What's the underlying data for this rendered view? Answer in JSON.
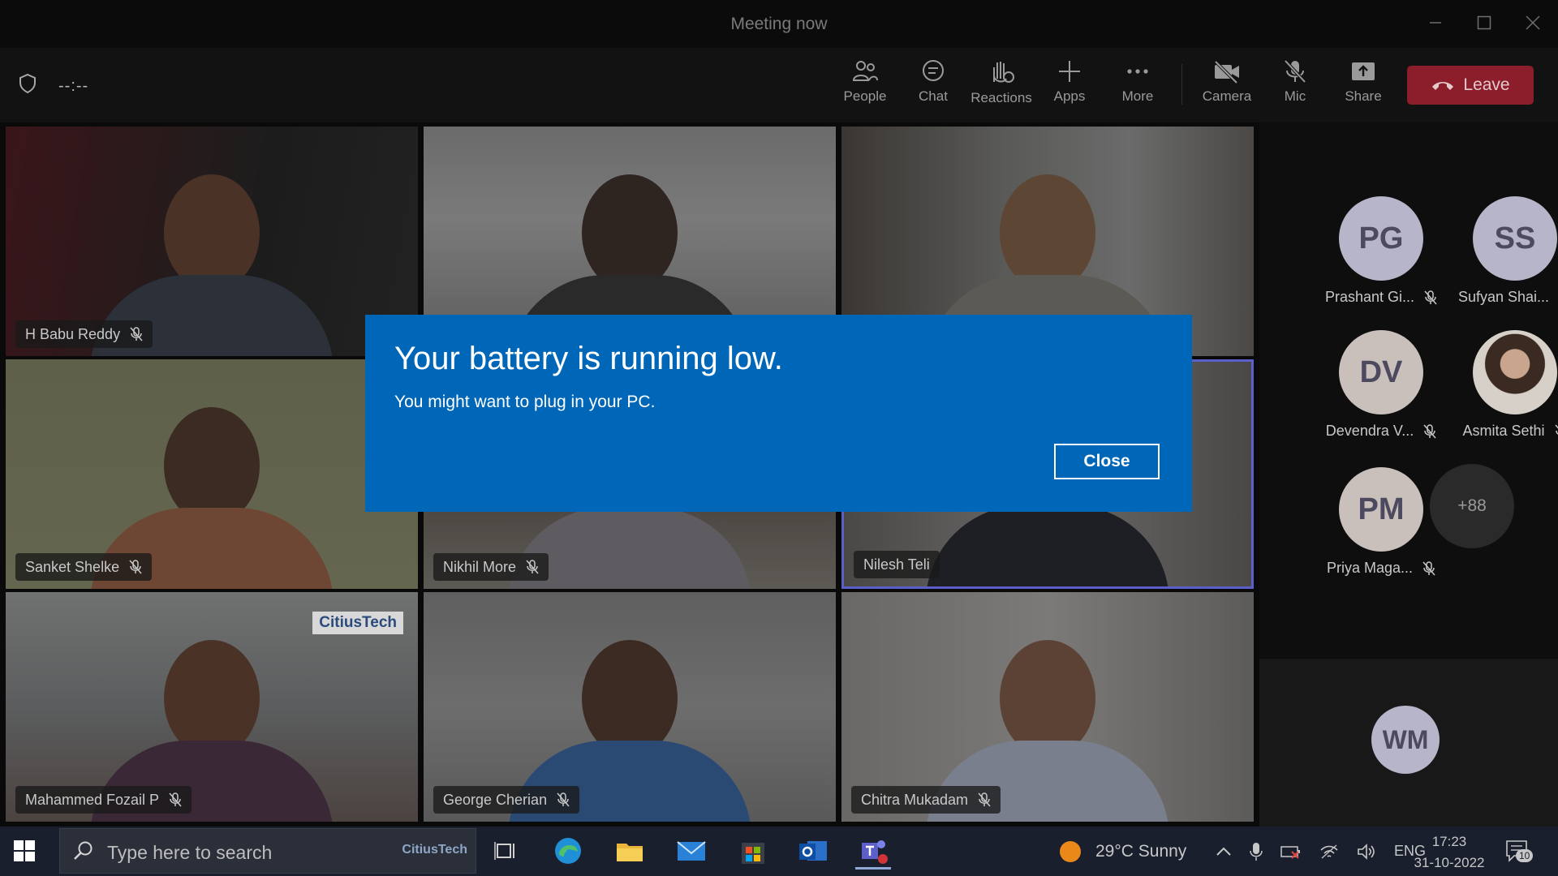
{
  "window": {
    "title": "Meeting now"
  },
  "toolbar": {
    "timer": "--:--",
    "buttons": {
      "people": "People",
      "chat": "Chat",
      "reactions": "Reactions",
      "apps": "Apps",
      "more": "More",
      "camera": "Camera",
      "mic": "Mic",
      "share": "Share"
    },
    "leave_label": "Leave",
    "leave_color": "#8c1d2b"
  },
  "videos": [
    {
      "name": "H Babu Reddy"
    },
    {
      "name": ""
    },
    {
      "name": ""
    },
    {
      "name": "Sanket Shelke"
    },
    {
      "name": "Nikhil More"
    },
    {
      "name": "Nilesh Teli"
    },
    {
      "name": "Mahammed Fozail P",
      "badge": "CitiusTech"
    },
    {
      "name": "George Cherian"
    },
    {
      "name": "Chitra Mukadam"
    }
  ],
  "roster": {
    "people": [
      {
        "initials": "PG",
        "name": "Prashant Gi..."
      },
      {
        "initials": "SS",
        "name": "Sufyan Shai..."
      },
      {
        "initials": "DV",
        "name": "Devendra V..."
      },
      {
        "initials": "",
        "name": "Asmita Sethi"
      },
      {
        "initials": "PM",
        "name": "Priya Maga..."
      }
    ],
    "more_count": "+88",
    "self_initials": "WM"
  },
  "dialog": {
    "title": "Your battery is running low.",
    "message": "You might want to plug in your PC.",
    "close_label": "Close",
    "color": "#0067b8"
  },
  "taskbar": {
    "search_placeholder": "Type here to search",
    "search_badge": "CitiusTech",
    "weather": "29°C  Sunny",
    "language": "ENG",
    "time": "17:23",
    "date": "31-10-2022",
    "notifications": "10"
  }
}
